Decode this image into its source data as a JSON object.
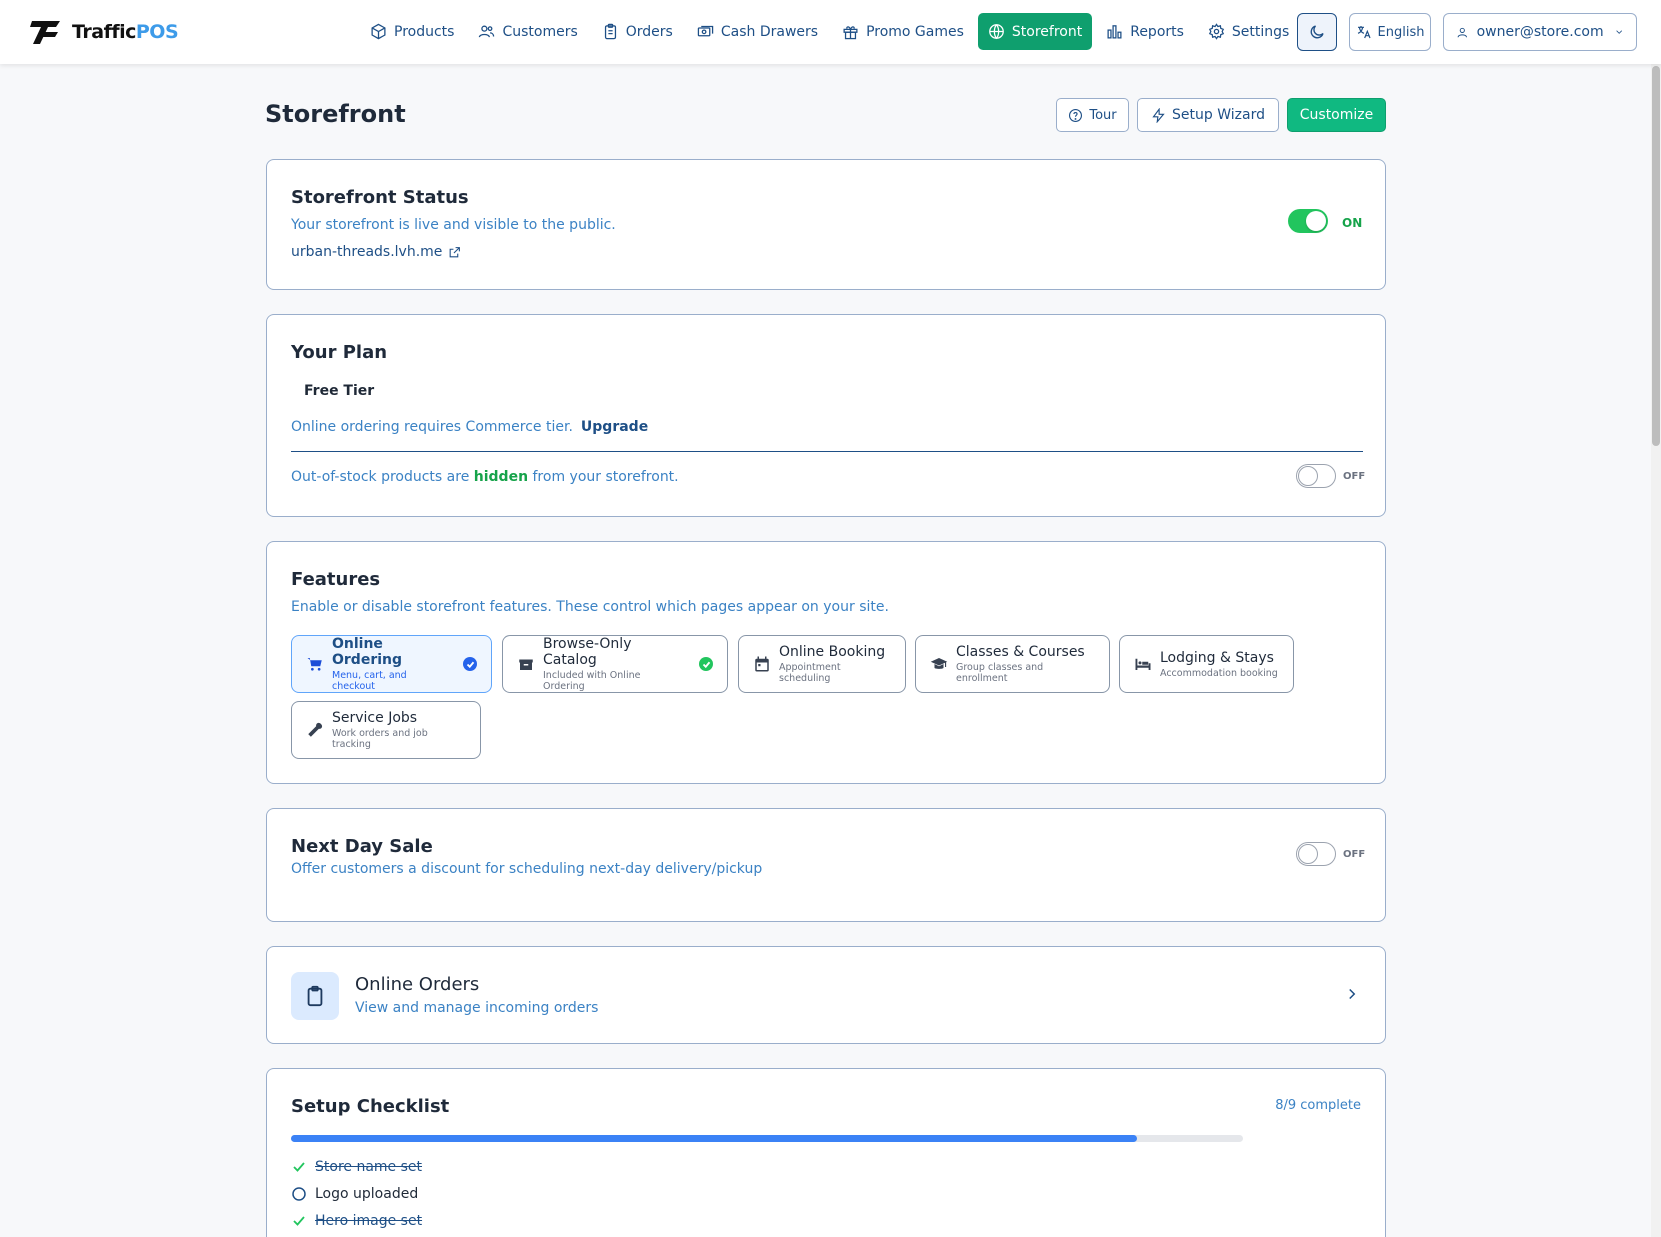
{
  "app": {
    "brand_main": "Traffic",
    "brand_accent": "POS"
  },
  "nav": {
    "items": [
      {
        "label": "Products",
        "icon": "box-icon"
      },
      {
        "label": "Customers",
        "icon": "users-icon"
      },
      {
        "label": "Orders",
        "icon": "clipboard-icon"
      },
      {
        "label": "Cash Drawers",
        "icon": "cash-icon"
      },
      {
        "label": "Promo Games",
        "icon": "gift-icon"
      },
      {
        "label": "Storefront",
        "icon": "globe-icon",
        "active": true
      },
      {
        "label": "Reports",
        "icon": "bar-chart-icon"
      },
      {
        "label": "Settings",
        "icon": "gear-icon"
      }
    ],
    "language": "English",
    "user": "owner@store.com"
  },
  "page": {
    "title": "Storefront",
    "tour_label": "Tour",
    "wizard_label": "Setup Wizard",
    "customize_label": "Customize"
  },
  "status": {
    "title": "Storefront Status",
    "subtitle": "Your storefront is live and visible to the public.",
    "url": "urban-threads.lvh.me",
    "toggle_label": "ON"
  },
  "plan": {
    "title": "Your Plan",
    "tier": "Free Tier",
    "notice": "Online ordering requires Commerce tier.",
    "upgrade_label": "Upgrade",
    "oos_prefix": "Out-of-stock products are",
    "oos_state": "hidden",
    "oos_suffix": "from your storefront.",
    "toggle_label": "OFF"
  },
  "features": {
    "title": "Features",
    "subtitle": "Enable or disable storefront features. These control which pages appear on your site.",
    "items": [
      {
        "name": "Online Ordering",
        "desc": "Menu, cart, and checkout",
        "icon": "cart-icon",
        "selected": true,
        "badge": "check-blue"
      },
      {
        "name": "Browse-Only Catalog",
        "desc": "Included with Online Ordering",
        "icon": "box-icon",
        "selected": false,
        "badge": "check-green"
      },
      {
        "name": "Online Booking",
        "desc": "Appointment scheduling",
        "icon": "calendar-icon",
        "selected": false
      },
      {
        "name": "Classes & Courses",
        "desc": "Group classes and enrollment",
        "icon": "graduation-cap-icon",
        "selected": false
      },
      {
        "name": "Lodging & Stays",
        "desc": "Accommodation booking",
        "icon": "bed-icon",
        "selected": false
      },
      {
        "name": "Service Jobs",
        "desc": "Work orders and job tracking",
        "icon": "wrench-icon",
        "selected": false
      }
    ]
  },
  "next_day": {
    "title": "Next Day Sale",
    "subtitle": "Offer customers a discount for scheduling next-day delivery/pickup",
    "toggle_label": "OFF"
  },
  "online_orders": {
    "title": "Online Orders",
    "subtitle": "View and manage incoming orders"
  },
  "checklist": {
    "title": "Setup Checklist",
    "progress_text": "8/9 complete",
    "progress_fraction": 0.889,
    "items": [
      {
        "label": "Store name set",
        "done": true
      },
      {
        "label": "Logo uploaded",
        "done": false
      },
      {
        "label": "Hero image set",
        "done": true
      }
    ]
  },
  "colors": {
    "accent": "#10b981",
    "primary_text": "#1e4f86",
    "link": "#3b82c4",
    "progress": "#3b82f6"
  }
}
